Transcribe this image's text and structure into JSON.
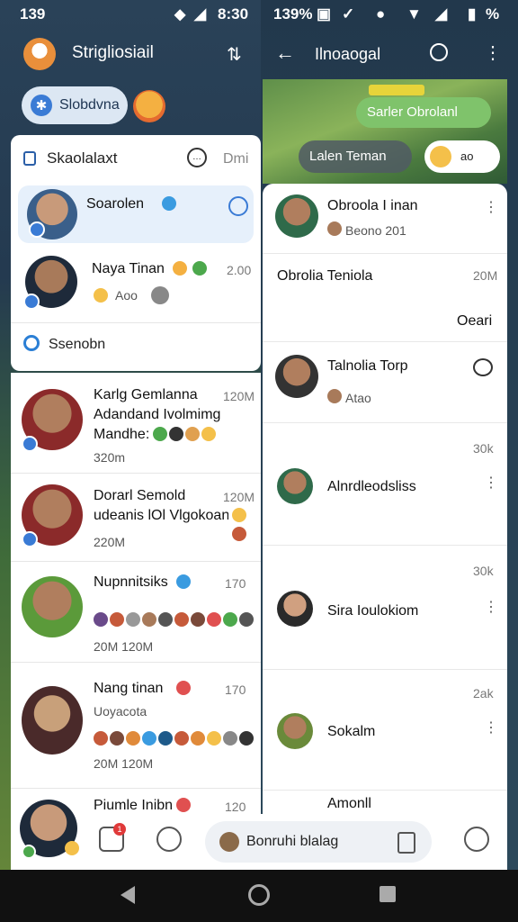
{
  "status_bar": {
    "time_left": "139",
    "time_right": "8:30",
    "right_text": "139%",
    "battery": "%"
  },
  "left": {
    "app_title": "Strigliosiail",
    "pill_label": "Slobdvna",
    "card": {
      "header": "Skaolalaxt",
      "header_right": "Dmi",
      "highlight": {
        "name": "Soarolen"
      },
      "row2": {
        "name": "Naya Tinan",
        "time": "2.00",
        "sub": "Aoo"
      },
      "search": "Ssenobn"
    },
    "list": [
      {
        "name": "Karlg Gemlanna",
        "line2": "Adandand Ivolmimg",
        "line3": "Mandhe:",
        "time": "120M",
        "footer": "320m"
      },
      {
        "name": "Dorarl Semold",
        "line2": "udeanis lOl Vlgokoan",
        "time": "120M",
        "footer": "220M"
      },
      {
        "name": "Nupnnitsiks",
        "time": "170",
        "footer": "20M 120M"
      },
      {
        "name": "Nang tinan",
        "line2": "Uoyacota",
        "time": "170",
        "footer": "20M 120M"
      },
      {
        "name": "Piumle Inibn",
        "time": "120"
      }
    ]
  },
  "right": {
    "title": "Ilnoaogal",
    "banner": {
      "bubble": "Sarler Obrolanl",
      "pill": "Lalen Teman",
      "pill2": "ao"
    },
    "rows": [
      {
        "name": "Obroola I inan",
        "sub": "Beono 201"
      },
      {
        "name": "Obrolia Teniola",
        "time": "20M",
        "extra": "Oeari"
      },
      {
        "name": "Talnolia Torp",
        "sub": "Atao"
      },
      {
        "time": "30k",
        "name": "Alnrdleodsliss"
      },
      {
        "time": "30k",
        "name": "Sira Ioulokiom"
      },
      {
        "time": "2ak",
        "name": "Sokalm"
      },
      {
        "name": "Amonll"
      }
    ]
  },
  "bottom_nav": {
    "compose_label": "Bonruhi blalag",
    "badge": "1"
  }
}
